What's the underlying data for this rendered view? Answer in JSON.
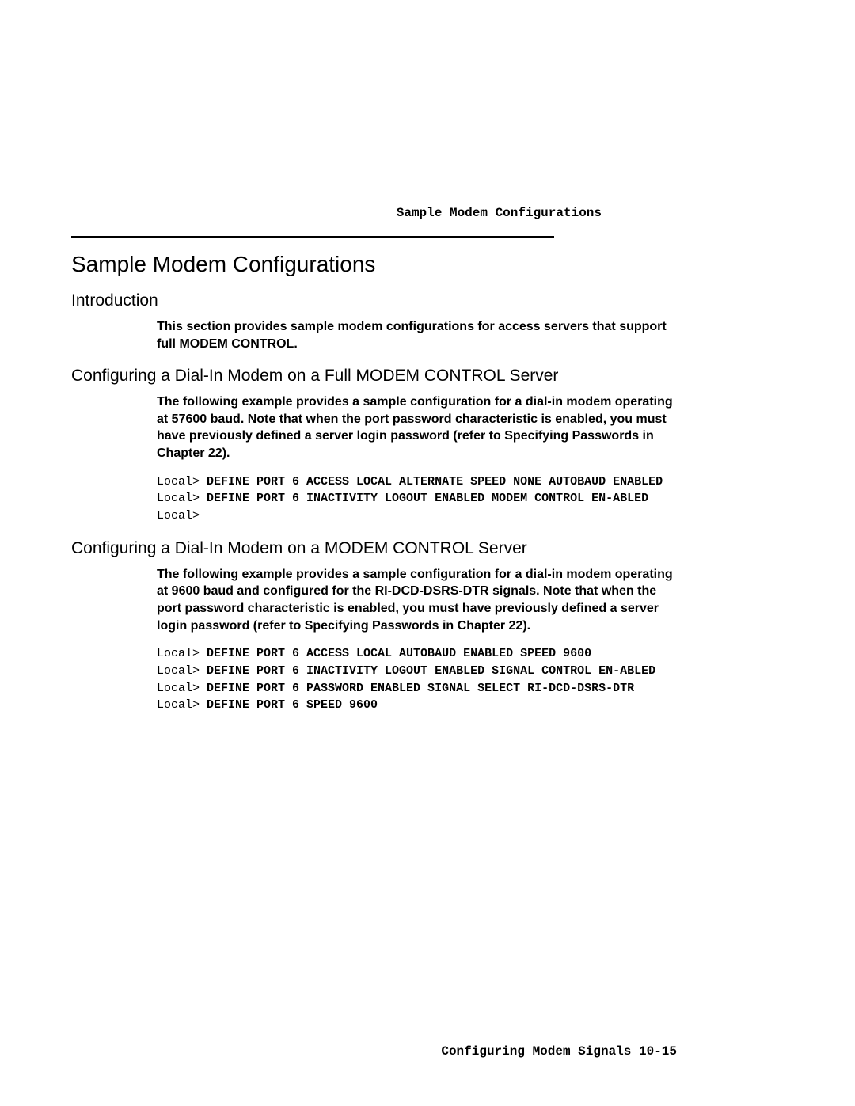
{
  "running_header": "Sample Modem Configurations",
  "title": "Sample Modem Configurations",
  "sections": {
    "intro": {
      "heading": "Introduction",
      "para": "This section provides sample modem configurations for access servers that support full MODEM CONTROL."
    },
    "full": {
      "heading": "Configuring a Dial-In Modem on a Full MODEM CONTROL Server",
      "para": "The following example provides a sample configuration for a dial-in modem operating at 57600 baud. Note that when the port password characteristic is enabled, you must have previously defined a server login password (refer to Specifying Passwords in Chapter 22).",
      "code": {
        "l1_prompt": "Local> ",
        "l1_cmd": "DEFINE PORT 6 ACCESS LOCAL ALTERNATE SPEED NONE AUTOBAUD ENABLED",
        "l2_prompt": "Local> ",
        "l2_cmd": "DEFINE PORT 6 INACTIVITY LOGOUT ENABLED MODEM CONTROL EN-ABLED",
        "l3_prompt": "Local>"
      }
    },
    "mc": {
      "heading": "Configuring a Dial-In Modem on a MODEM CONTROL Server",
      "para": "The following example provides a sample configuration for a dial-in modem operating at 9600 baud and configured for the RI-DCD-DSRS-DTR signals. Note that when the port password characteristic is enabled, you must have previously defined a server login password (refer to Specifying Passwords in Chapter 22).",
      "code": {
        "l1_prompt": "Local> ",
        "l1_cmd": "DEFINE PORT 6 ACCESS LOCAL AUTOBAUD ENABLED SPEED 9600",
        "l2_prompt": "Local> ",
        "l2_cmd": "DEFINE PORT 6 INACTIVITY LOGOUT ENABLED SIGNAL CONTROL EN-ABLED",
        "l3_prompt": "Local> ",
        "l3_cmd": "DEFINE PORT 6 PASSWORD ENABLED SIGNAL SELECT RI-DCD-DSRS-DTR",
        "l4_prompt": "Local> ",
        "l4_cmd": "DEFINE PORT 6 SPEED 9600"
      }
    }
  },
  "footer": "Configuring Modem Signals 10-15"
}
